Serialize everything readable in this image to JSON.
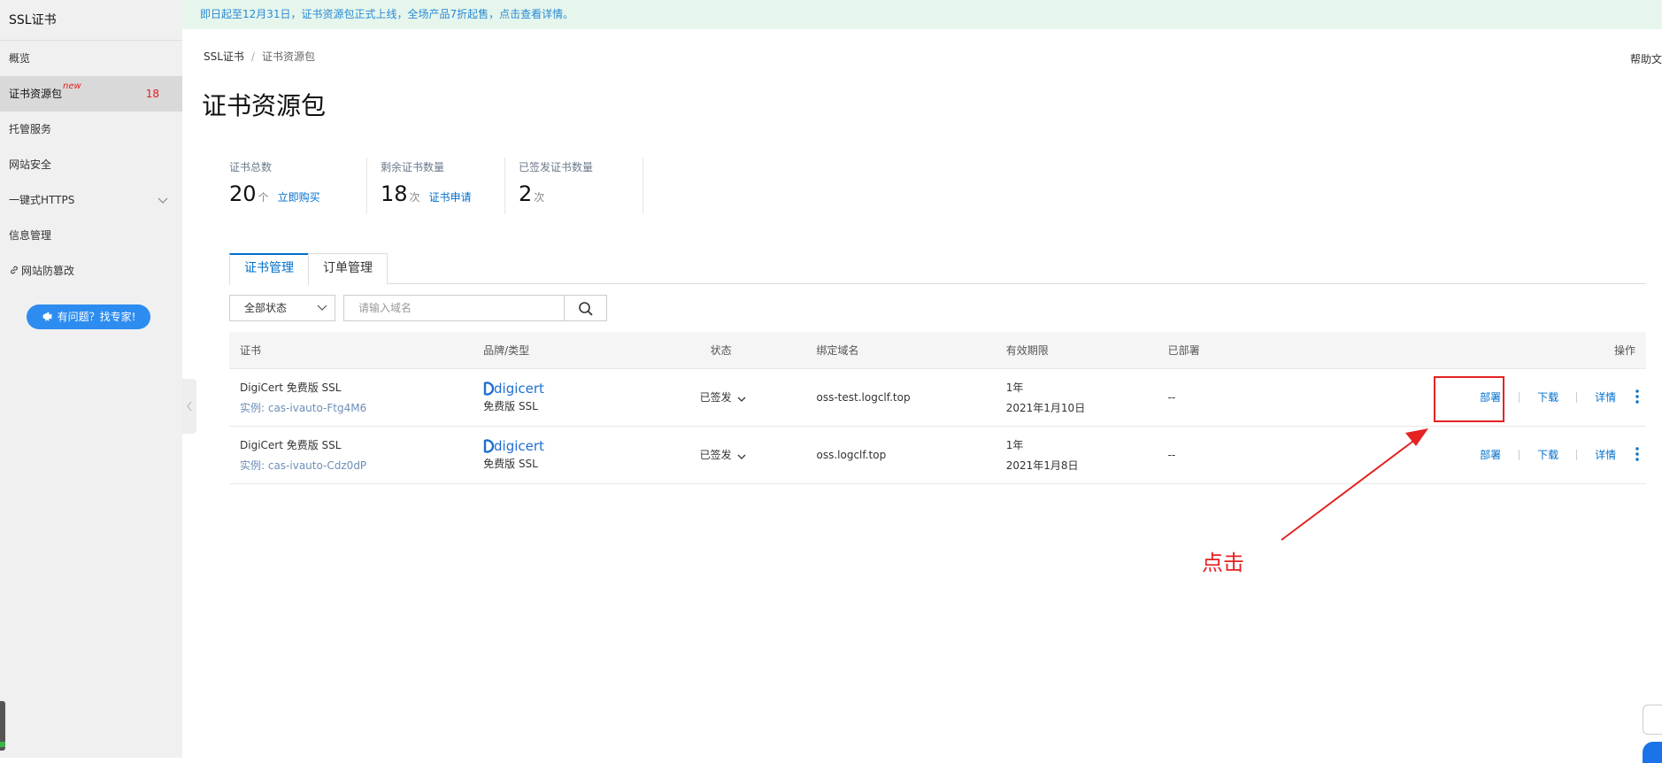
{
  "sidebar": {
    "title": "SSL证书",
    "items": [
      {
        "label": "概览"
      },
      {
        "label": "证书资源包",
        "tag": "new",
        "count": "18"
      },
      {
        "label": "托管服务"
      },
      {
        "label": "网站安全"
      },
      {
        "label": "一键式HTTPS"
      },
      {
        "label": "信息管理"
      },
      {
        "label": "网站防篡改"
      }
    ],
    "help_button": "有问题？找专家!"
  },
  "banner": {
    "text": "即日起至12月31日，证书资源包正式上线，全场产品7折起售，点击查看详情。"
  },
  "breadcrumb": [
    "SSL证书",
    "证书资源包"
  ],
  "help_doc": "帮助文",
  "page_title": "证书资源包",
  "stats": [
    {
      "label": "证书总数",
      "value": "20",
      "unit": "个",
      "link": "立即购买"
    },
    {
      "label": "剩余证书数量",
      "value": "18",
      "unit": "次",
      "link": "证书申请"
    },
    {
      "label": "已签发证书数量",
      "value": "2",
      "unit": "次"
    }
  ],
  "tabs": [
    "证书管理",
    "订单管理"
  ],
  "filter": {
    "status": "全部状态",
    "search_placeholder": "请输入域名"
  },
  "table": {
    "headers": [
      "证书",
      "品牌/类型",
      "状态",
      "绑定域名",
      "有效期限",
      "已部署",
      "操作"
    ],
    "rows": [
      {
        "cert": "DigiCert 免费版 SSL",
        "instance": "实例: cas-ivauto-Ftg4M6",
        "brand": "digicert",
        "type": "免费版 SSL",
        "status": "已签发",
        "domain": "oss-test.logclf.top",
        "validity_1": "1年",
        "validity_2": "2021年1月10日",
        "deployed": "--",
        "ops": [
          "部署",
          "下载",
          "详情"
        ]
      },
      {
        "cert": "DigiCert 免费版 SSL",
        "instance": "实例: cas-ivauto-Cdz0dP",
        "brand": "digicert",
        "type": "免费版 SSL",
        "status": "已签发",
        "domain": "oss.logclf.top",
        "validity_1": "1年",
        "validity_2": "2021年1月8日",
        "deployed": "--",
        "ops": [
          "部署",
          "下载",
          "详情"
        ]
      }
    ]
  },
  "annotation": {
    "text": "点击",
    "color": "#e52222"
  },
  "colors": {
    "link": "#0070cc",
    "accent": "#2d8cf0",
    "banner_bg": "#e6f6ec",
    "banner_text": "#2a8ad6"
  }
}
